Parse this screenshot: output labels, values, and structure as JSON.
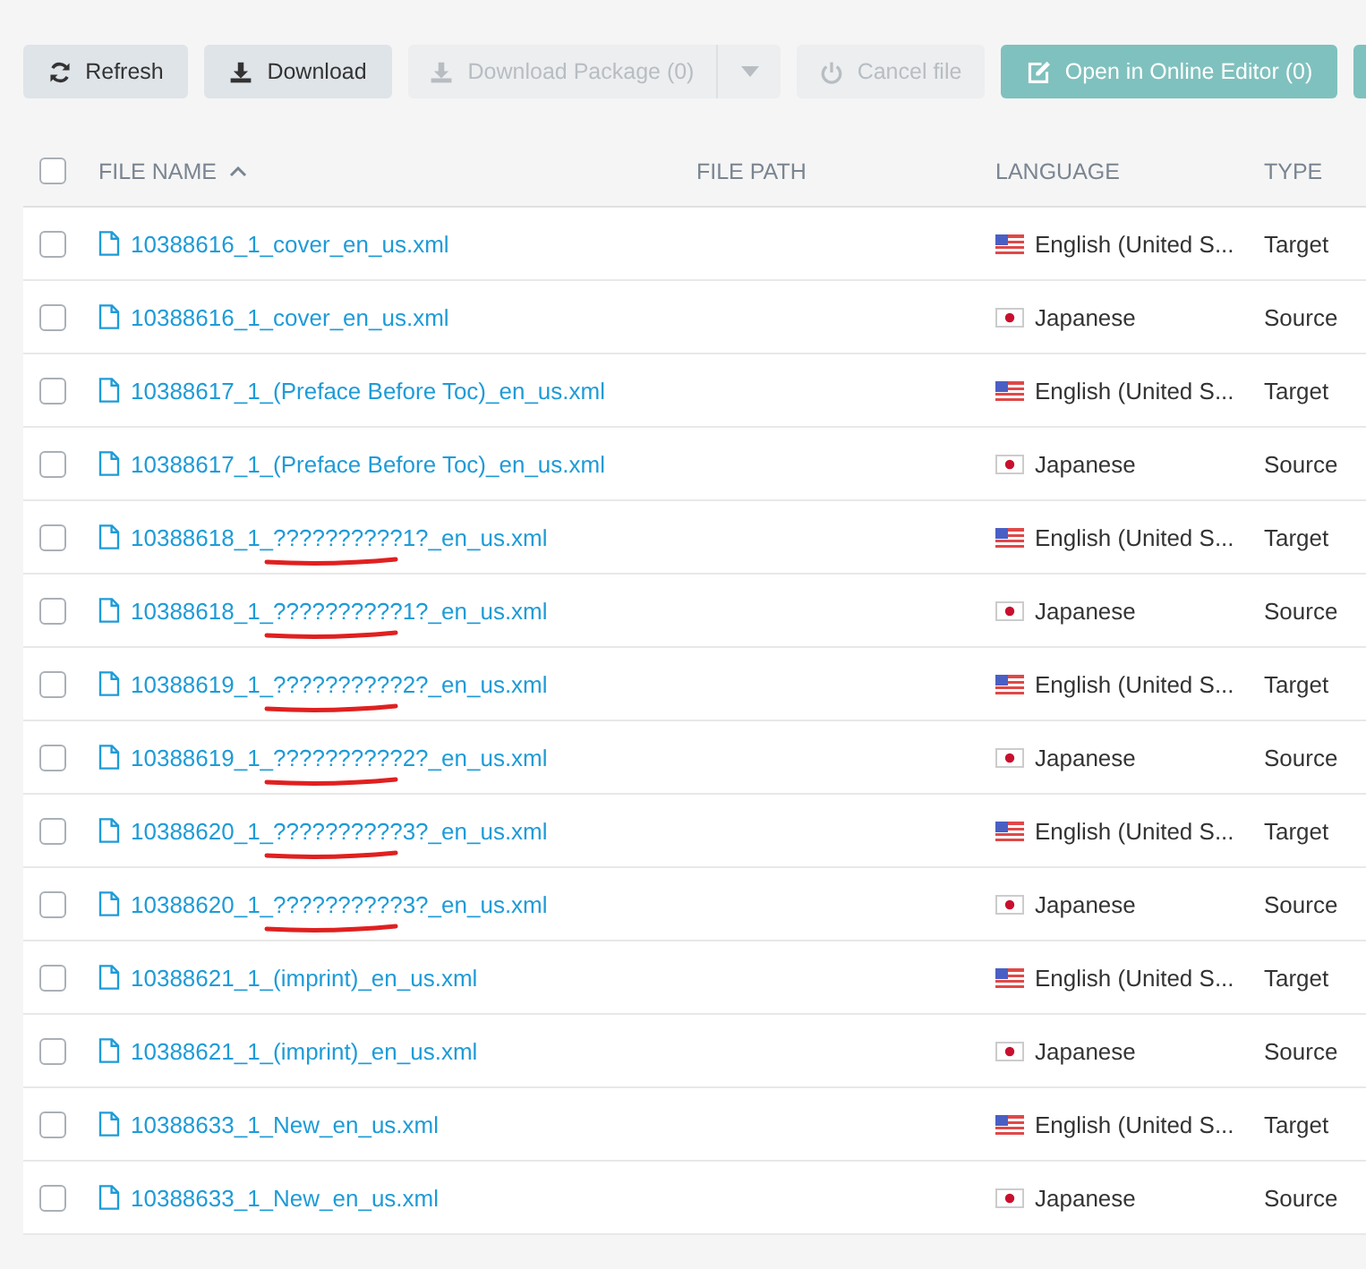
{
  "toolbar": {
    "buttons": [
      {
        "label": "Refresh",
        "kind": "refresh",
        "disabled": false
      },
      {
        "label": "Download",
        "kind": "download",
        "disabled": false
      },
      {
        "label": "Download Package (0)",
        "kind": "package",
        "disabled": true
      },
      {
        "label": "Cancel file",
        "kind": "cancel",
        "disabled": true
      },
      {
        "label": "Open in Online Editor (0)",
        "kind": "editor",
        "disabled": true
      },
      {
        "kind": "edge"
      }
    ]
  },
  "table": {
    "select_all": {
      "checked": false
    },
    "columns": [
      {
        "label": "FILE NAME",
        "sorted": true
      },
      {
        "label": "FILE PATH",
        "sorted": false
      },
      {
        "label": "LANGUAGE",
        "sorted": false
      },
      {
        "label": "TYPE",
        "sorted": false
      }
    ],
    "rows": [
      {
        "checked": false,
        "file_name": "10388616_1_cover_en_us.xml",
        "language": "English (United S...",
        "kind": "us",
        "type": "Target",
        "annotated": false
      },
      {
        "checked": false,
        "file_name": "10388616_1_cover_en_us.xml",
        "language": "Japanese",
        "kind": "jp",
        "type": "Source",
        "annotated": false
      },
      {
        "checked": false,
        "file_name": "10388617_1_(Preface Before Toc)_en_us.xml",
        "language": "English (United S...",
        "kind": "us",
        "type": "Target",
        "annotated": false
      },
      {
        "checked": false,
        "file_name": "10388617_1_(Preface Before Toc)_en_us.xml",
        "language": "Japanese",
        "kind": "jp",
        "type": "Source",
        "annotated": false
      },
      {
        "checked": false,
        "file_name": "10388618_1_??????????1?_en_us.xml",
        "language": "English (United S...",
        "kind": "us",
        "type": "Target",
        "annotated": true
      },
      {
        "checked": false,
        "file_name": "10388618_1_??????????1?_en_us.xml",
        "language": "Japanese",
        "kind": "jp",
        "type": "Source",
        "annotated": true
      },
      {
        "checked": false,
        "file_name": "10388619_1_??????????2?_en_us.xml",
        "language": "English (United S...",
        "kind": "us",
        "type": "Target",
        "annotated": true
      },
      {
        "checked": false,
        "file_name": "10388619_1_??????????2?_en_us.xml",
        "language": "Japanese",
        "kind": "jp",
        "type": "Source",
        "annotated": true
      },
      {
        "checked": false,
        "file_name": "10388620_1_??????????3?_en_us.xml",
        "language": "English (United S...",
        "kind": "us",
        "type": "Target",
        "annotated": true
      },
      {
        "checked": false,
        "file_name": "10388620_1_??????????3?_en_us.xml",
        "language": "Japanese",
        "kind": "jp",
        "type": "Source",
        "annotated": true
      },
      {
        "checked": false,
        "file_name": "10388621_1_(imprint)_en_us.xml",
        "language": "English (United S...",
        "kind": "us",
        "type": "Target",
        "annotated": false
      },
      {
        "checked": false,
        "file_name": "10388621_1_(imprint)_en_us.xml",
        "language": "Japanese",
        "kind": "jp",
        "type": "Source",
        "annotated": false
      },
      {
        "checked": false,
        "file_name": "10388633_1_New_en_us.xml",
        "language": "English (United S...",
        "kind": "us",
        "type": "Target",
        "annotated": false
      },
      {
        "checked": false,
        "file_name": "10388633_1_New_en_us.xml",
        "language": "Japanese",
        "kind": "jp",
        "type": "Source",
        "annotated": false
      }
    ]
  }
}
